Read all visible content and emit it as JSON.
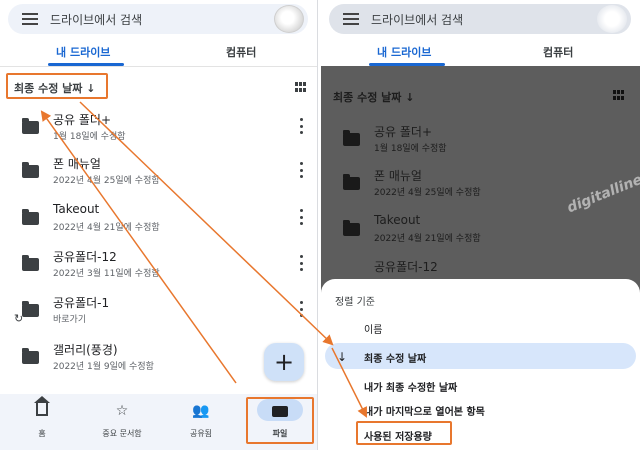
{
  "left": {
    "search_text": "드라이브에서 검색",
    "tabs": [
      "내 드라이브",
      "컴퓨터"
    ],
    "sort_label": "최종 수정 날짜 ↓",
    "files": [
      {
        "name": "공유 폴더+",
        "meta": "1월 18일에 수정함"
      },
      {
        "name": "폰 매뉴얼",
        "meta": "2022년 4월 25일에 수정함"
      },
      {
        "name": "Takeout",
        "meta": "2022년 4월 21일에 수정함"
      },
      {
        "name": "공유폴더-12",
        "meta": "2022년 3월 11일에 수정함"
      },
      {
        "name": "공유폴더-1",
        "meta": "바로가기"
      },
      {
        "name": "갤러리(풍경)",
        "meta": "2022년 1월 9일에 수정함"
      }
    ],
    "fab_symbol": "+",
    "nav": [
      {
        "label": "홈"
      },
      {
        "label": "중요 문서함"
      },
      {
        "label": "공유됨"
      },
      {
        "label": "파일"
      }
    ]
  },
  "right": {
    "search_text": "드라이브에서 검색",
    "tabs": [
      "내 드라이브",
      "컴퓨터"
    ],
    "sort_label": "최종 수정 날짜 ↓",
    "files": [
      {
        "name": "공유 폴더+",
        "meta": "1월 18일에 수정함"
      },
      {
        "name": "폰 매뉴얼",
        "meta": "2022년 4월 25일에 수정함"
      },
      {
        "name": "Takeout",
        "meta": "2022년 4월 21일에 수정함"
      },
      {
        "name": "공유폴더-12",
        "meta": ""
      }
    ],
    "sheet": {
      "title": "정렬 기준",
      "options": [
        "이름",
        "최종 수정 날짜",
        "내가 최종 수정한 날짜",
        "내가 마지막으로 열어본 항목",
        "사용된 저장용량"
      ],
      "selected_index": 1
    },
    "watermark": "digitalline"
  },
  "colors": {
    "accent": "#1967d2",
    "annotation": "#e8772e"
  },
  "icons": {
    "menu": "menu-icon",
    "folder": "folder-icon",
    "more": "more-vert-icon",
    "grid": "grid-view-icon",
    "home": "home-icon",
    "starred": "star-icon",
    "shared": "people-icon",
    "files": "folder-icon",
    "shortcut": "shortcut-arrow-icon"
  }
}
